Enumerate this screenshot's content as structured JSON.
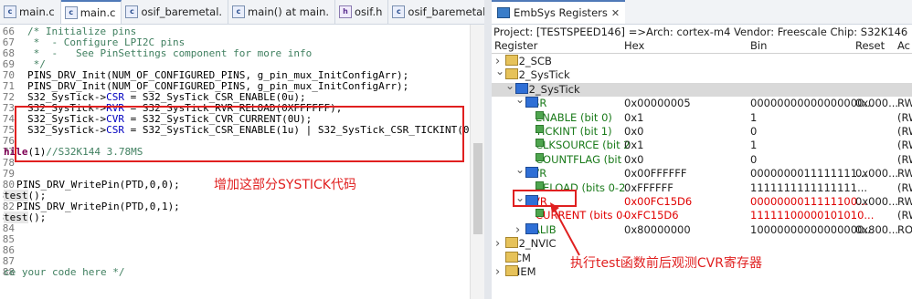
{
  "editor": {
    "tabs": [
      {
        "label": "main.c",
        "icon": "c-file-icon",
        "active": false
      },
      {
        "label": "main.c",
        "icon": "c-file-icon",
        "active": true
      },
      {
        "label": "osif_baremetal.",
        "icon": "c-file-icon",
        "active": false
      },
      {
        "label": "main() at main.",
        "icon": "c-file-icon",
        "active": false
      },
      {
        "label": "osif.h",
        "icon": "h-file-icon",
        "active": false
      },
      {
        "label": "osif_baremetal.",
        "icon": "c-file-icon",
        "active": false
      },
      {
        "label": "»3",
        "icon": "overflow-icon",
        "active": false
      }
    ],
    "lines": [
      {
        "n": "66",
        "text": "/* Initialize pins"
      },
      {
        "n": "67",
        "text": " *  - Configure LPI2C pins"
      },
      {
        "n": "68",
        "text": " *  -   See PinSettings component for more info"
      },
      {
        "n": "69",
        "text": " */"
      },
      {
        "n": "70",
        "text": "PINS_DRV_Init(NUM_OF_CONFIGURED_PINS, g_pin_mux_InitConfigArr);"
      },
      {
        "n": "71",
        "text": "PINS_DRV_Init(NUM_OF_CONFIGURED_PINS, g_pin_mux_InitConfigArr);"
      },
      {
        "n": "72",
        "text": "S32_SysTick->CSR = S32_SysTick_CSR_ENABLE(0u);"
      },
      {
        "n": "73",
        "text": "S32_SysTick->RVR = S32_SysTick_RVR_RELOAD(0XFFFFFF);"
      },
      {
        "n": "74",
        "text": "S32_SysTick->CVR = S32_SysTick_CVR_CURRENT(0U);"
      },
      {
        "n": "75",
        "text": "S32_SysTick->CSR = S32_SysTick_CSR_ENABLE(1u) | S32_SysTick_CSR_TICKINT(0u)"
      },
      {
        "n": "76",
        "text": ""
      },
      {
        "n": "77",
        "text": "hile(1)//S32K144 3.78MS"
      },
      {
        "n": "78",
        "text": ""
      },
      {
        "n": "79",
        "text": ""
      },
      {
        "n": "80",
        "text": "PINS_DRV_WritePin(PTD,0,0);"
      },
      {
        "n": "81",
        "text": "test();"
      },
      {
        "n": "82",
        "text": "PINS_DRV_WritePin(PTD,0,1);"
      },
      {
        "n": "83",
        "text": "test();"
      },
      {
        "n": "84",
        "text": ""
      },
      {
        "n": "85",
        "text": ""
      },
      {
        "n": "86",
        "text": ""
      },
      {
        "n": "87",
        "text": ""
      },
      {
        "n": "88",
        "text": "ce your code here */"
      }
    ],
    "annotation": "增加这部分SYSTICK代码"
  },
  "registers": {
    "tab_label": "EmbSys Registers",
    "project_line": "Project: [TESTSPEED146] =>Arch: cortex-m4  Vendor: Freescale  Chip: S32K146  Board: ---  no",
    "columns": [
      "Register",
      "Hex",
      "Bin",
      "Reset",
      "Ac"
    ],
    "rows": [
      {
        "indent": 0,
        "tw": ">",
        "icon": "folder",
        "name": "S32_SCB",
        "hex": "",
        "bin": "",
        "reset": "",
        "acc": ""
      },
      {
        "indent": 0,
        "tw": "v",
        "icon": "folder",
        "name": "S32_SysTick",
        "hex": "",
        "bin": "",
        "reset": "",
        "acc": ""
      },
      {
        "indent": 1,
        "tw": "v",
        "icon": "register",
        "name": "S32_SysTick",
        "hex": "",
        "bin": "",
        "reset": "",
        "acc": "",
        "selected": true
      },
      {
        "indent": 2,
        "tw": "v",
        "icon": "register",
        "name": "CSR",
        "hex": "0x00000005",
        "bin": "00000000000000000...",
        "reset": "0x000...",
        "acc": "RW"
      },
      {
        "indent": 3,
        "tw": "",
        "icon": "bit",
        "name": "ENABLE (bit 0)",
        "hex": "0x1",
        "bin": "1",
        "reset": "",
        "acc": "(RW"
      },
      {
        "indent": 3,
        "tw": "",
        "icon": "bit",
        "name": "TICKINT (bit 1)",
        "hex": "0x0",
        "bin": "0",
        "reset": "",
        "acc": "(RW"
      },
      {
        "indent": 3,
        "tw": "",
        "icon": "bit",
        "name": "CLKSOURCE (bit 2",
        "hex": "0x1",
        "bin": "1",
        "reset": "",
        "acc": "(RW"
      },
      {
        "indent": 3,
        "tw": "",
        "icon": "bit",
        "name": "COUNTFLAG (bit",
        "hex": "0x0",
        "bin": "0",
        "reset": "",
        "acc": "(RW"
      },
      {
        "indent": 2,
        "tw": "v",
        "icon": "register",
        "name": "RVR",
        "hex": "0x00FFFFFF",
        "bin": "0000000011111111...",
        "reset": "0x000...",
        "acc": "RW"
      },
      {
        "indent": 3,
        "tw": "",
        "icon": "bit",
        "name": "RELOAD (bits 0-2",
        "hex": "0xFFFFFF",
        "bin": "1111111111111111...",
        "reset": "",
        "acc": "(RW"
      },
      {
        "indent": 2,
        "tw": "v",
        "icon": "register",
        "name": "CVR",
        "hex": "0x00FC15D6",
        "bin": "0000000011111100...",
        "reset": "0x000...",
        "acc": "RW",
        "changed": true
      },
      {
        "indent": 3,
        "tw": "",
        "icon": "bit",
        "name": "CURRENT (bits 0-",
        "hex": "0xFC15D6",
        "bin": "11111100000101010...",
        "reset": "",
        "acc": "(RW",
        "changed": true
      },
      {
        "indent": 2,
        "tw": ">",
        "icon": "register",
        "name": "CALIB",
        "hex": "0x80000000",
        "bin": "10000000000000000...",
        "reset": "0x800...",
        "acc": "RO"
      },
      {
        "indent": 0,
        "tw": ">",
        "icon": "folder",
        "name": "S32_NVIC",
        "hex": "",
        "bin": "",
        "reset": "",
        "acc": ""
      },
      {
        "indent": 0,
        "tw": "",
        "icon": "folder",
        "name": "MCM",
        "hex": "",
        "bin": "",
        "reset": "",
        "acc": ""
      },
      {
        "indent": 0,
        "tw": ">",
        "icon": "folder",
        "name": "LMEM",
        "hex": "",
        "bin": "",
        "reset": "",
        "acc": ""
      }
    ],
    "annotation": "执行test函数前后观测CVR寄存器"
  },
  "colors": {
    "annotation": "#e02020",
    "changed": "#e00000",
    "field": "#0000c0",
    "comment": "#3f7f5f"
  }
}
